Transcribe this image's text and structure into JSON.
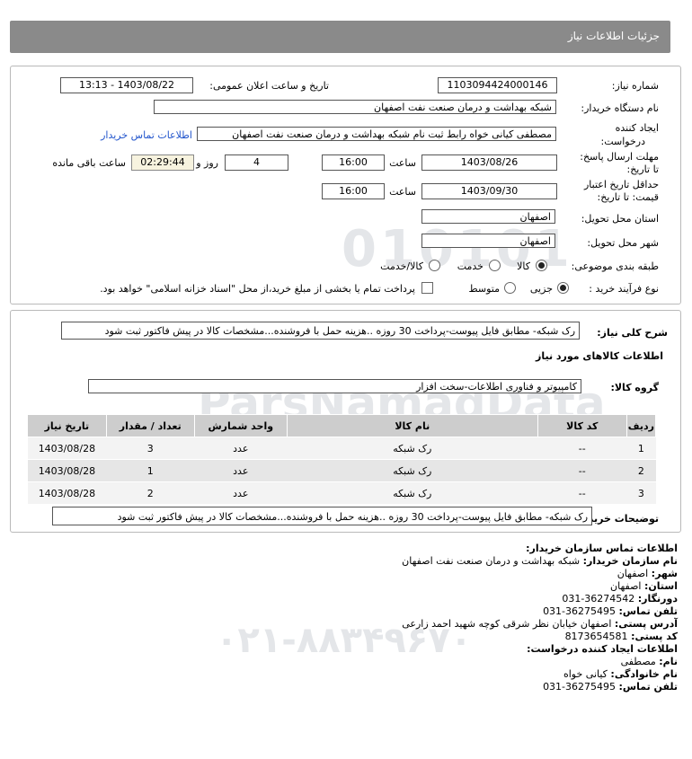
{
  "page": {
    "title": "جزئيات اطلاعات نياز"
  },
  "watermark": {
    "number": "010101",
    "brand": "ParsNamadData",
    "line1": "مرکز فراوری اطلاعات پارس نماد داده ها",
    "line2": "پایگاه اطلاع رسانی مناقصه و مزایده",
    "phone": "۰۲۱-۸۸۳۴۹۶۷۰"
  },
  "form": {
    "need_number_label": "شماره نیاز:",
    "need_number": "1103094424000146",
    "announce_label": "تاریخ و ساعت اعلان عمومی:",
    "announce_value": "1403/08/22 - 13:13",
    "buyer_org_label": "نام دستگاه خریدار:",
    "buyer_org": "شبکه بهداشت و درمان صنعت نفت اصفهان",
    "creator_label_1": "ایجاد کننده",
    "creator_label_2": "درخواست:",
    "creator": "مصطفی کیانی خواه رابط ثبت نام شبکه بهداشت و درمان صنعت نفت اصفهان",
    "contact_link": "اطلاعات تماس خریدار",
    "reply_deadline_label_1": "مهلت ارسال پاسخ:",
    "reply_deadline_label_2": "تا تاریخ:",
    "reply_date": "1403/08/26",
    "time_label": "ساعت",
    "reply_time": "16:00",
    "days_value": "4",
    "days_label": "روز و",
    "remaining_time": "02:29:44",
    "remaining_label": "ساعت باقی مانده",
    "validity_label_1": "حداقل تاریخ اعتبار",
    "validity_label_2": "قیمت: تا تاریخ:",
    "validity_date": "1403/09/30",
    "validity_time": "16:00",
    "province_label": "استان محل تحویل:",
    "province": "اصفهان",
    "city_label": "شهر محل تحویل:",
    "city": "اصفهان",
    "category_label": "طبقه بندی موضوعی:",
    "category_options": [
      "کالا",
      "خدمت",
      "کالا/خدمت"
    ],
    "process_label": "نوع فرآیند خرید :",
    "process_options": [
      "جزیی",
      "متوسط"
    ],
    "payment_note": "پرداخت تمام یا بخشی از مبلغ خرید،از محل \"اسناد خزانه اسلامی\" خواهد بود."
  },
  "details": {
    "summary_label": "شرح کلی نیاز:",
    "summary": "رک شبکه- مطابق فایل پیوست-پرداخت 30 روزه ..هزینه حمل با فروشنده...مشخصات کالا در پیش فاکتور ثبت شود",
    "goods_info_title": "اطلاعات کالاهای مورد نیاز",
    "goods_group_label": "گروه کالا:",
    "goods_group": "کامپیوتر و فناوری اطلاعات-سخت افزار",
    "table_headers": [
      "ردیف",
      "کد کالا",
      "نام کالا",
      "واحد شمارش",
      "تعداد / مقدار",
      "تاریخ نیاز"
    ],
    "rows": [
      [
        "1",
        "--",
        "رک شبکه",
        "عدد",
        "3",
        "1403/08/28"
      ],
      [
        "2",
        "--",
        "رک شبکه",
        "عدد",
        "1",
        "1403/08/28"
      ],
      [
        "3",
        "--",
        "رک شبکه",
        "عدد",
        "2",
        "1403/08/28"
      ]
    ],
    "buyer_notes_label": "توضیحات خریدار:",
    "buyer_notes": "رک شبکه- مطابق فایل پیوست-پرداخت 30 روزه ..هزینه حمل با فروشنده...مشخصات کالا در پیش فاکتور ثبت شود"
  },
  "contact": {
    "title": "اطلاعات تماس سازمان خریدار:",
    "org_label": "نام سازمان خریدار:",
    "org": "شبکه بهداشت و درمان صنعت نفت اصفهان",
    "city_label": "شهر:",
    "city": "اصفهان",
    "province_label": "استان:",
    "province": "اصفهان",
    "fax_label": "دورنگار:",
    "fax": "031-36274542",
    "phone_label": "تلفن تماس:",
    "phone": "031-36275495",
    "address_label": "آدرس پستی:",
    "address": "اصفهان خیابان نظر شرقی کوچه شهید احمد زارعی",
    "postal_label": "کد پستی:",
    "postal": "8173654581",
    "creator_title": "اطلاعات ایجاد کننده درخواست:",
    "first_name_label": "نام:",
    "first_name": "مصطفی",
    "last_name_label": "نام خانوادگی:",
    "last_name": "کیانی خواه",
    "creator_phone_label": "تلفن تماس:",
    "creator_phone": "031-36275495"
  }
}
